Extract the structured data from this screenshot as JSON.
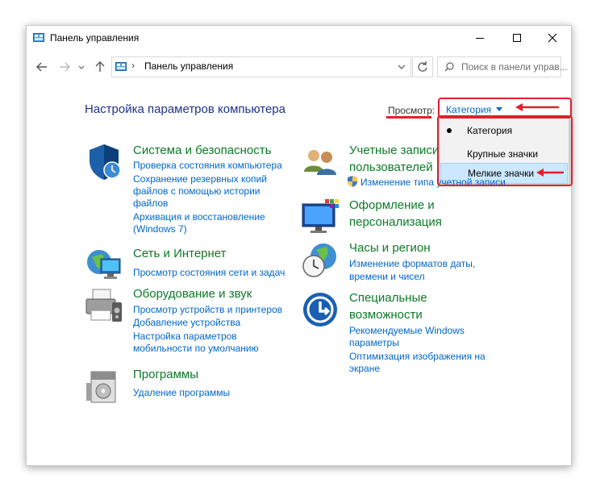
{
  "window": {
    "title": "Панель управления"
  },
  "navbar": {
    "address_path": "Панель управления",
    "search_placeholder": "Поиск в панели управ..."
  },
  "header": {
    "heading": "Настройка параметров компьютера",
    "view_label": "Просмотр:",
    "view_value": "Категория"
  },
  "view_menu": {
    "items": [
      {
        "label": "Категория",
        "selected": true
      },
      {
        "label": "Крупные значки",
        "selected": false
      },
      {
        "label": "Мелкие значки",
        "selected": false,
        "highlighted": true
      }
    ]
  },
  "categories": {
    "system": {
      "title": "Система и безопасность",
      "links": [
        "Проверка состояния компьютера",
        "Сохранение резервных копий",
        "файлов с помощью истории",
        "файлов",
        "Архивация и восстановление",
        "(Windows 7)"
      ]
    },
    "network": {
      "title": "Сеть и Интернет",
      "links": [
        "Просмотр состояния сети и задач"
      ]
    },
    "hardware": {
      "title": "Оборудование и звук",
      "links": [
        "Просмотр устройств и принтеров",
        "Добавление устройства",
        "Настройка параметров",
        "мобильности по умолчанию"
      ]
    },
    "programs": {
      "title": "Программы",
      "links": [
        "Удаление программы"
      ]
    },
    "users": {
      "title_line1": "Учетные записи",
      "title_line2": "пользователей",
      "links": [
        "Изменение типа учетной записи"
      ]
    },
    "appearance": {
      "title_line1": "Оформление и",
      "title_line2": "персонализация",
      "links": []
    },
    "clock": {
      "title": "Часы и регион",
      "links": [
        "Изменение форматов даты,",
        "времени и чисел"
      ]
    },
    "access": {
      "title_line1": "Специальные",
      "title_line2": "возможности",
      "links": [
        "Рекомендуемые Windows",
        "параметры",
        "Оптимизация изображения на",
        "экране"
      ]
    }
  },
  "colors": {
    "accent_link": "#0066cc",
    "category_title": "#0c7a27",
    "heading": "#1e3287",
    "annotation": "#e0212b"
  }
}
